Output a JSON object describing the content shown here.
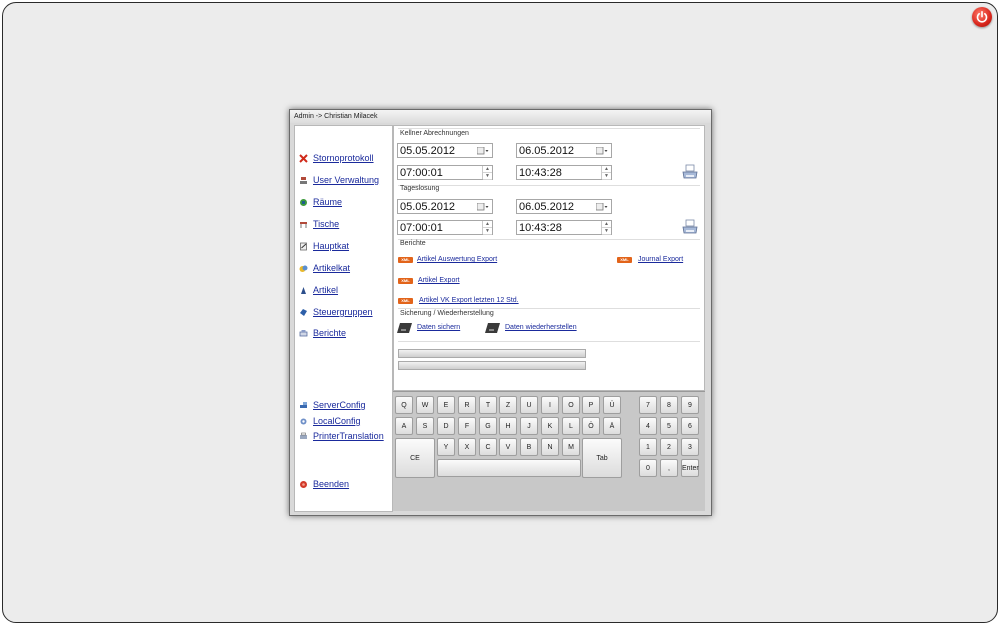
{
  "window": {
    "title": "Admin -> Christian Milacek"
  },
  "sidebar": {
    "items": [
      {
        "label": "Stornoprotokoll",
        "icon": "delete-x-icon"
      },
      {
        "label": "User Verwaltung",
        "icon": "user-icon"
      },
      {
        "label": "Räume",
        "icon": "rooms-icon"
      },
      {
        "label": "Tische",
        "icon": "table-icon"
      },
      {
        "label": "Hauptkat",
        "icon": "notepad-icon"
      },
      {
        "label": "Artikelkat",
        "icon": "coins-icon"
      },
      {
        "label": "Artikel",
        "icon": "article-icon"
      },
      {
        "label": "Steuergruppen",
        "icon": "tax-icon"
      },
      {
        "label": "Berichte",
        "icon": "reports-icon"
      }
    ],
    "config_items": [
      {
        "label": "ServerConfig",
        "icon": "server-icon"
      },
      {
        "label": "LocalConfig",
        "icon": "local-icon"
      },
      {
        "label": "PrinterTranslation",
        "icon": "printer-translation-icon"
      }
    ],
    "exit": {
      "label": "Beenden",
      "icon": "exit-icon"
    }
  },
  "kellner": {
    "title": "Kellner Abrechnungen",
    "date_from": "05.05.2012",
    "date_to": "06.05.2012",
    "time_from": "07:00:01",
    "time_to": "10:43:28"
  },
  "tageslosung": {
    "title": "Tageslosung",
    "date_from": "05.05.2012",
    "date_to": "06.05.2012",
    "time_from": "07:00:01",
    "time_to": "10:43:28"
  },
  "berichte": {
    "title": "Berichte",
    "badge": "XML",
    "links": [
      "Artikel Auswertung Export",
      "Journal Export",
      "Artikel Export",
      "Artikel VK Export letzten 12 Std."
    ]
  },
  "sicherung": {
    "title": "Sicherung / Wiederherstellung",
    "save_label": "Daten sichern",
    "restore_label": "Daten wiederherstellen"
  },
  "keyboard": {
    "row1": [
      "Q",
      "W",
      "E",
      "R",
      "T",
      "Z",
      "U",
      "I",
      "O",
      "P",
      "Ü"
    ],
    "row2": [
      "A",
      "S",
      "D",
      "F",
      "G",
      "H",
      "J",
      "K",
      "L",
      "Ö",
      "Ä"
    ],
    "row3": [
      "Y",
      "X",
      "C",
      "V",
      "B",
      "N",
      "M"
    ],
    "ce": "CE",
    "tab": "Tab",
    "numpad": [
      [
        "7",
        "8",
        "9"
      ],
      [
        "4",
        "5",
        "6"
      ],
      [
        "1",
        "2",
        "3"
      ]
    ],
    "zero": "0",
    "comma": ",",
    "enter": "Enter"
  },
  "colors": {
    "link": "#1a2a9c",
    "xml_badge": "#e2641a",
    "power": "#d8261c"
  }
}
